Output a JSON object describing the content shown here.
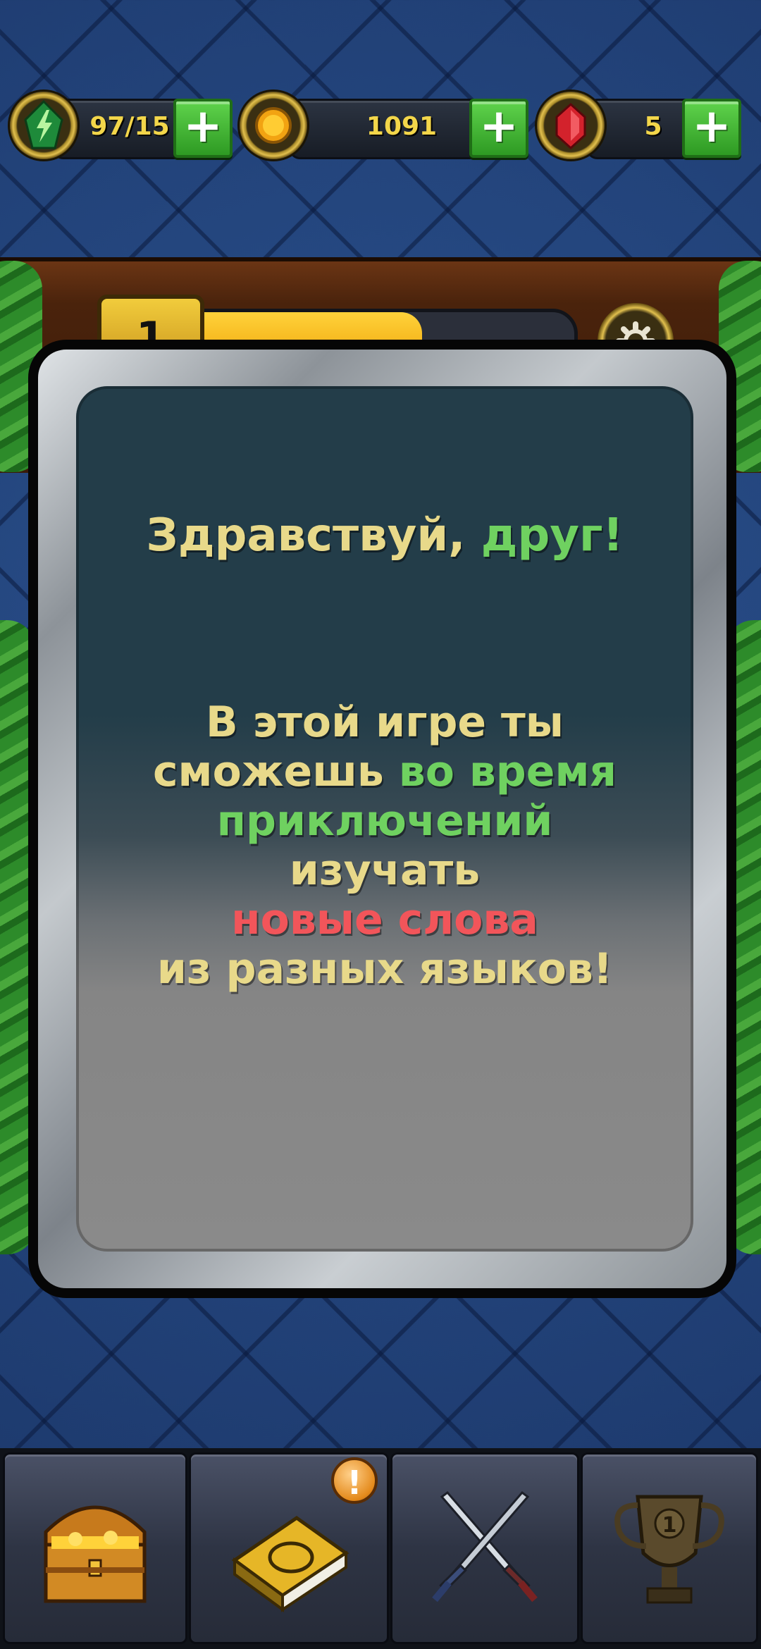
{
  "resources": {
    "energy": {
      "value": "97/15",
      "icon": "lightning-icon"
    },
    "coins": {
      "value": "1091",
      "icon": "coin-icon"
    },
    "gems": {
      "value": "5",
      "icon": "ruby-icon"
    },
    "plus_label": "+"
  },
  "level": {
    "number": "1",
    "xp_fraction": 0.6
  },
  "dialog": {
    "greeting_part1": "Здравствуй, ",
    "greeting_part2": "друг!",
    "line1": "В этой игре ты",
    "line2_part1": "сможешь ",
    "line2_part2": "во время",
    "line3": "приключений",
    "line4": "изучать",
    "line5": "новые слова",
    "line6": "из разных языков!"
  },
  "colors": {
    "accent_yellow": "#e8d98a",
    "accent_green": "#6fd160",
    "accent_red": "#f2555a"
  },
  "bottom_nav": [
    {
      "name": "treasure-chest",
      "icon": "treasure-chest-icon"
    },
    {
      "name": "spellbook",
      "icon": "book-icon",
      "alert": "!"
    },
    {
      "name": "battle",
      "icon": "crossed-swords-icon"
    },
    {
      "name": "leaderboard",
      "icon": "trophy-icon",
      "rank": "1"
    }
  ]
}
